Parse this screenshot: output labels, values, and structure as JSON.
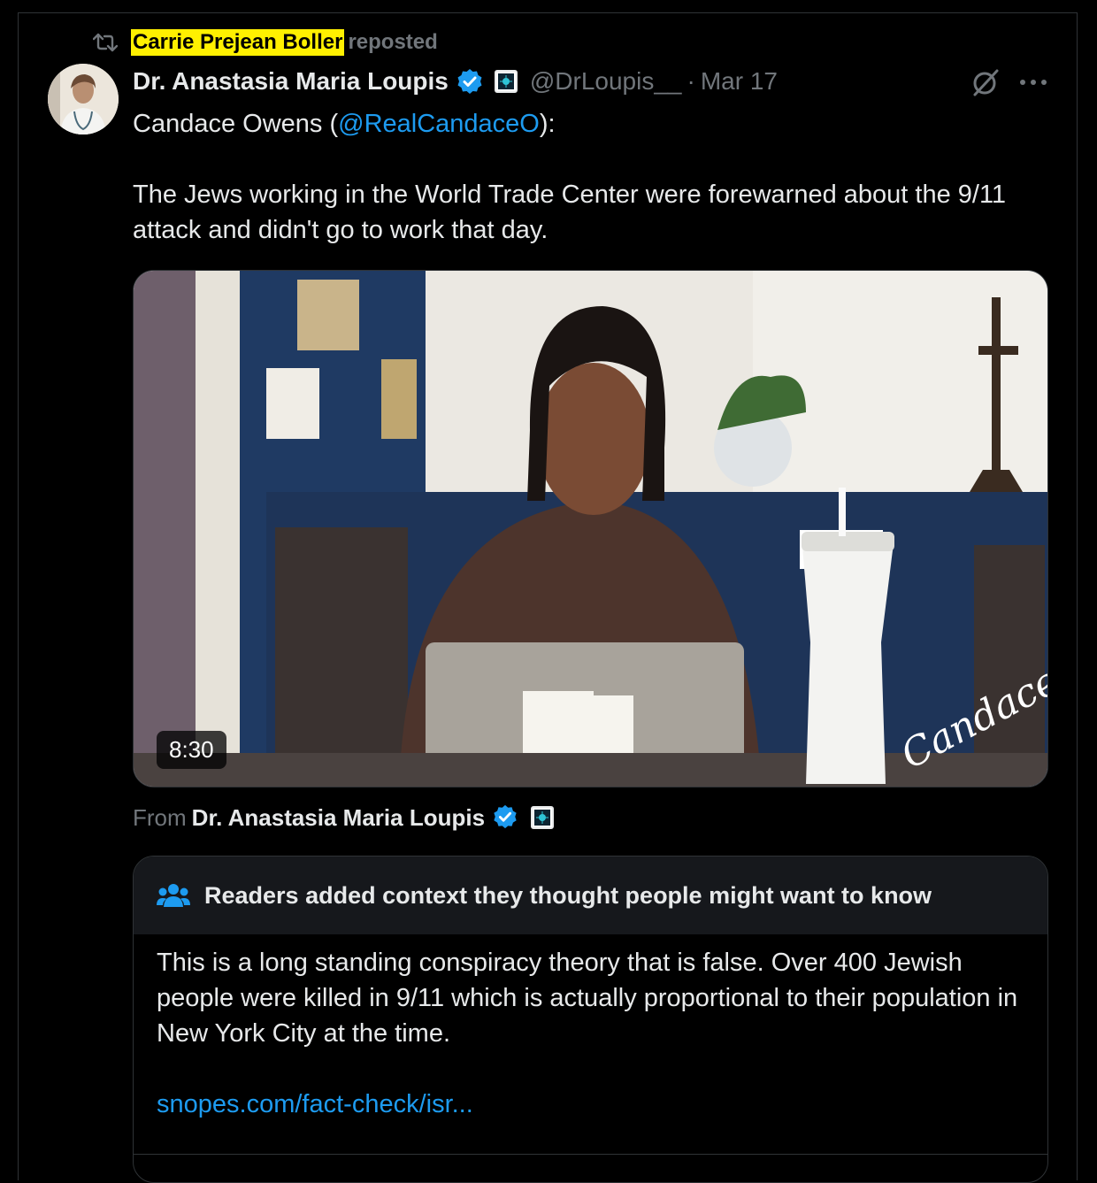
{
  "repost": {
    "reposter": "Carrie Prejean Boller",
    "label": "reposted"
  },
  "post": {
    "author_name": "Dr. Anastasia Maria Loupis",
    "handle": "@DrLoupis__",
    "separator": "·",
    "date": "Mar 17",
    "text_prefix": "Candace Owens (",
    "mention": "@RealCandaceO",
    "text_suffix": "):",
    "body": "The Jews working in the World Trade Center were forewarned about the 9/11 attack and didn't go to work that day."
  },
  "media": {
    "duration": "8:30",
    "signature": "Candace"
  },
  "from": {
    "label": "From",
    "name": "Dr. Anastasia Maria Loupis"
  },
  "community_note": {
    "title": "Readers added context they thought people might want to know",
    "body": "This is a long standing conspiracy theory that is false. Over 400 Jewish people were killed in 9/11 which is actually proportional to their population in New York City at the time.",
    "link": "snopes.com/fact-check/isr..."
  },
  "colors": {
    "accent": "#1d9bf0",
    "highlight": "#fff000",
    "muted": "#71767b",
    "background": "#000000"
  },
  "icons": [
    "repost-icon",
    "verified-badge-icon",
    "affiliate-badge-icon",
    "grok-icon",
    "more-icon",
    "people-icon"
  ]
}
